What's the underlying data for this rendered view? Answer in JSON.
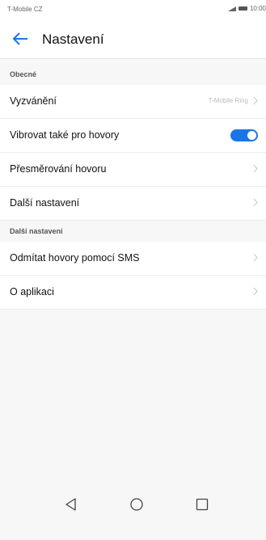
{
  "status_bar": {
    "carrier": "T-Mobile CZ",
    "time": "10:00"
  },
  "header": {
    "title": "Nastavení"
  },
  "sections": [
    {
      "title": "Obecné",
      "items": [
        {
          "label": "Vyzvánění",
          "value": "T-Mobile Ring"
        },
        {
          "label": "Vibrovat také pro hovory",
          "toggle_on": true
        },
        {
          "label": "Přesměrování hovoru"
        },
        {
          "label": "Další nastavení"
        }
      ]
    },
    {
      "title": "Další nastavení",
      "items": [
        {
          "label": "Odmítat hovory pomocí SMS"
        },
        {
          "label": "O aplikaci"
        }
      ]
    }
  ],
  "icons": {
    "back": "arrow-left-icon",
    "chevron": "chevron-right-icon",
    "nav_back": "triangle-back-icon",
    "nav_home": "circle-home-icon",
    "nav_recents": "square-recents-icon"
  },
  "colors": {
    "accent": "#1976e8"
  }
}
